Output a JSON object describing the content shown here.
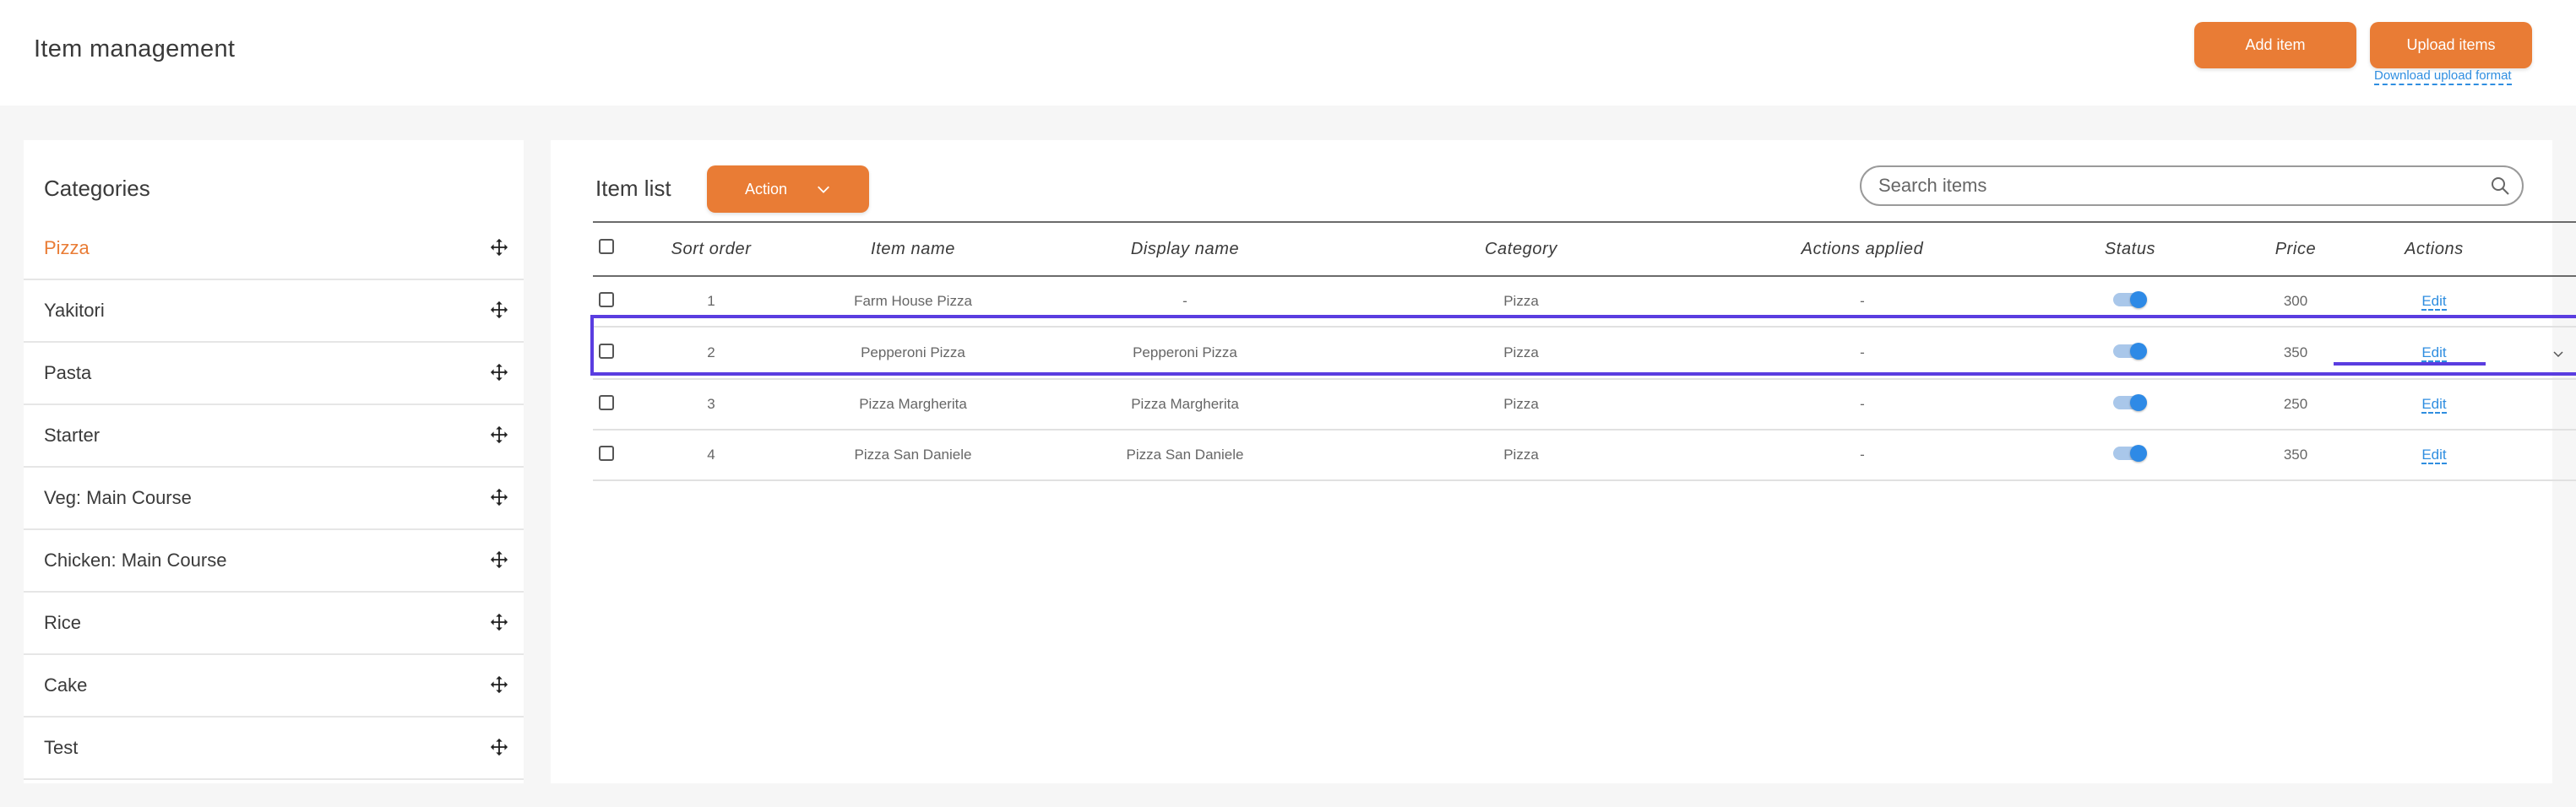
{
  "header": {
    "title": "Item management",
    "add_item_label": "Add item",
    "upload_items_label": "Upload items",
    "download_format_label": "Download upload format"
  },
  "categories": {
    "heading": "Categories",
    "active": "Pizza",
    "items": [
      {
        "label": "Pizza"
      },
      {
        "label": "Yakitori"
      },
      {
        "label": "Pasta"
      },
      {
        "label": "Starter"
      },
      {
        "label": "Veg: Main Course"
      },
      {
        "label": "Chicken: Main Course"
      },
      {
        "label": "Rice"
      },
      {
        "label": "Cake"
      },
      {
        "label": "Test"
      }
    ]
  },
  "items": {
    "heading": "Item list",
    "action_label": "Action",
    "search_placeholder": "Search items",
    "columns": [
      "Sort order",
      "Item name",
      "Display name",
      "Category",
      "Actions applied",
      "Status",
      "Price",
      "Actions"
    ],
    "rows": [
      {
        "sort": "1",
        "name": "Farm House Pizza",
        "display": "-",
        "category": "Pizza",
        "applied": "-",
        "status_on": true,
        "price": "300",
        "action": "Edit"
      },
      {
        "sort": "2",
        "name": "Pepperoni Pizza",
        "display": "Pepperoni Pizza",
        "category": "Pizza",
        "applied": "-",
        "status_on": true,
        "price": "350",
        "action": "Edit"
      },
      {
        "sort": "3",
        "name": "Pizza Margherita",
        "display": "Pizza Margherita",
        "category": "Pizza",
        "applied": "-",
        "status_on": true,
        "price": "250",
        "action": "Edit"
      },
      {
        "sort": "4",
        "name": "Pizza San Daniele",
        "display": "Pizza San Daniele",
        "category": "Pizza",
        "applied": "-",
        "status_on": true,
        "price": "350",
        "action": "Edit"
      }
    ]
  },
  "colors": {
    "accent": "#e97c35",
    "link": "#2f8ee0",
    "highlight": "#5a3de0",
    "toggle_on": "#2e8ae6"
  }
}
